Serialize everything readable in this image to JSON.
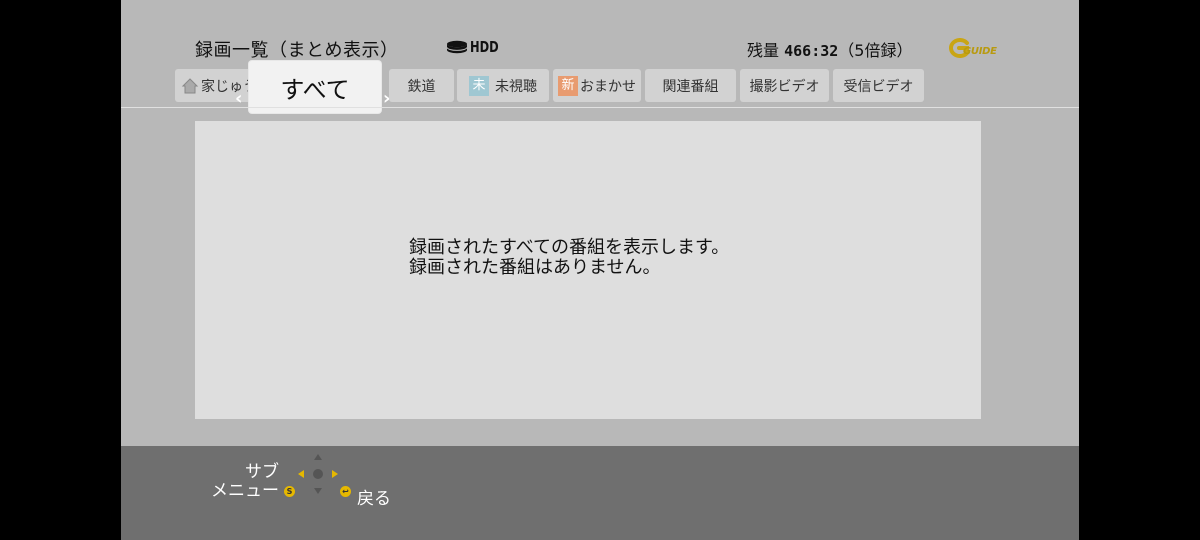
{
  "header": {
    "title": "録画一覧（まとめ表示）",
    "storage_label": "HDD",
    "remaining_prefix": "残量",
    "remaining_time": "466:32",
    "remaining_mode": "（5倍録）",
    "logo_text": "GUIDE"
  },
  "tabs": [
    {
      "label": "家じゅう",
      "icon": "house-icon"
    },
    {
      "label": "すべて",
      "active": true
    },
    {
      "label": "鉄道"
    },
    {
      "label": "未視聴",
      "badge": "未"
    },
    {
      "label": "おまかせ",
      "badge": "新"
    },
    {
      "label": "関連番組"
    },
    {
      "label": "撮影ビデオ"
    },
    {
      "label": "受信ビデオ"
    }
  ],
  "message": {
    "line1": "録画されたすべての番組を表示します。",
    "line2": "録画された番組はありません。"
  },
  "footer": {
    "sub_line1": "サブ",
    "sub_line2": "メニュー",
    "back_label": "戻る"
  },
  "colors": {
    "screen_bg": "#b8b8b8",
    "panel_bg": "#dedede",
    "footer_bg": "#6f6f6f",
    "accent_yellow": "#e6b800",
    "unwatched_badge": "#9fc7d2",
    "new_badge": "#e89b70"
  }
}
